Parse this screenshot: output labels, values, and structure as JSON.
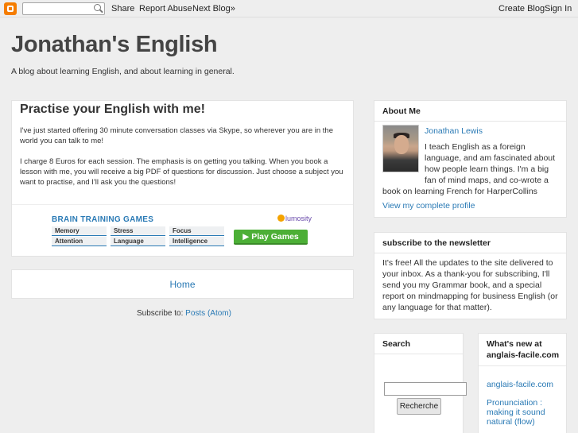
{
  "navbar": {
    "share": "Share",
    "report_abuse": "Report Abuse",
    "next_blog": "Next Blog»",
    "create_blog": "Create Blog",
    "sign_in": "Sign In"
  },
  "header": {
    "title": "Jonathan's English",
    "description": "A blog about learning English, and about learning in general."
  },
  "post": {
    "title": "Practise your English with me!",
    "paragraphs": [
      "I've just started offering 30 minute conversation classes via Skype, so wherever you are in the world you can talk to me!",
      "I charge 8 Euros for each session. The emphasis is on getting you talking. When you book a lesson with me, you will receive a big PDF of questions for discussion. Just choose a subject you want to practise, and I'll ask you the questions!"
    ]
  },
  "ad": {
    "title": "BRAIN TRAINING GAMES",
    "logo": "lumosity",
    "cells": [
      "Memory",
      "Stress",
      "Focus",
      "Attention",
      "Language",
      "Intelligence"
    ],
    "button": "Play Games",
    "colors": {
      "title": "#2a7ab5",
      "button": "#4caf36"
    }
  },
  "nav": {
    "home": "Home",
    "subscribe_label": "Subscribe to:",
    "subscribe_link": "Posts (Atom)"
  },
  "sidebar": {
    "about": {
      "heading": "About Me",
      "name": "Jonathan Lewis",
      "bio_lines": [
        "I teach English as a foreign",
        "language, and am fascinated about",
        "how people learn things. I'm a big",
        "fan of mind maps, and co-wrote a"
      ],
      "bio_last": "book on learning French for HarperCollins",
      "profile_link": "View my complete profile"
    },
    "newsletter": {
      "heading": "subscribe to the newsletter",
      "lines": [
        "It's free! All the updates to the site delivered to",
        "your inbox. As a thank-you for subscribing, I'll",
        "send you my Grammar book, and a special",
        "report on mindmapping for business English (or",
        "any language for that matter)."
      ]
    },
    "search": {
      "heading": "Search",
      "button": "Recherche"
    },
    "whats_new": {
      "heading_line1": "What's new at",
      "heading_line2": "anglais-facile.com",
      "link1": "anglais-facile.com",
      "link2_lines": [
        "Pronunciation :",
        "making it sound",
        "natural (flow)"
      ]
    }
  },
  "colors": {
    "link": "#2a7ab5",
    "background": "#eeeeee",
    "blogger_orange": "#f57d00"
  }
}
